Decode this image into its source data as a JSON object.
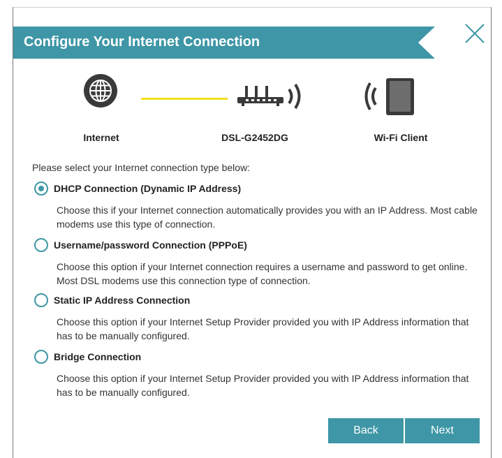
{
  "dialog": {
    "title": "Configure Your Internet Connection",
    "close_icon": "close-x-icon"
  },
  "diagram": {
    "internet_label": "Internet",
    "router_label": "DSL-G2452DG",
    "client_label": "Wi-Fi Client",
    "icons": [
      "globe-icon",
      "router-icon",
      "tablet-icon"
    ],
    "link_color": "#f2e01e"
  },
  "prompt": "Please select your Internet connection type below:",
  "options": [
    {
      "label": "DHCP Connection (Dynamic IP Address)",
      "description": "Choose this if your Internet connection automatically provides you with an IP Address. Most cable modems use this type of connection.",
      "selected": true
    },
    {
      "label": "Username/password Connection (PPPoE)",
      "description": "Choose this option if your Internet connection requires a username and password to get online. Most DSL modems use this connection type of connection.",
      "selected": false
    },
    {
      "label": "Static IP Address Connection",
      "description": "Choose this option if your Internet Setup Provider provided you with IP Address information that has to be manually configured.",
      "selected": false
    },
    {
      "label": "Bridge Connection",
      "description": "Choose this option if your Internet Setup Provider provided you with IP Address information that has to be manually configured.",
      "selected": false
    }
  ],
  "buttons": {
    "back": "Back",
    "next": "Next"
  },
  "colors": {
    "accent": "#3e96a6",
    "icon_dark": "#3a3a3a"
  }
}
